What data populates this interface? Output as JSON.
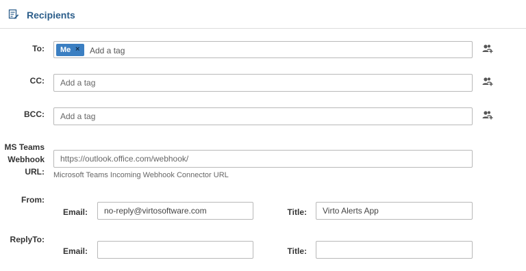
{
  "header": {
    "title": "Recipients",
    "icon": "edit-list-icon"
  },
  "to": {
    "label": "To:",
    "tags": [
      {
        "text": "Me",
        "remove": "×"
      }
    ],
    "placeholder": "Add a tag",
    "icon": "address-book-icon"
  },
  "cc": {
    "label": "CC:",
    "placeholder": "Add a tag",
    "icon": "address-book-icon"
  },
  "bcc": {
    "label": "BCC:",
    "placeholder": "Add a tag",
    "icon": "address-book-icon"
  },
  "teams": {
    "label_lines": [
      "MS Teams",
      "Webhook",
      "URL:"
    ],
    "placeholder": "https://outlook.office.com/webhook/",
    "hint": "Microsoft Teams Incoming Webhook Connector URL"
  },
  "from": {
    "label": "From:",
    "email_label": "Email:",
    "email_value": "no-reply@virtosoftware.com",
    "title_label": "Title:",
    "title_value": "Virto Alerts App"
  },
  "replyto": {
    "label": "ReplyTo:",
    "email_label": "Email:",
    "email_value": "",
    "title_label": "Title:",
    "title_value": ""
  },
  "colors": {
    "accent": "#2b5d8a",
    "tag_bg": "#3b7fc2",
    "icon": "#555555"
  }
}
